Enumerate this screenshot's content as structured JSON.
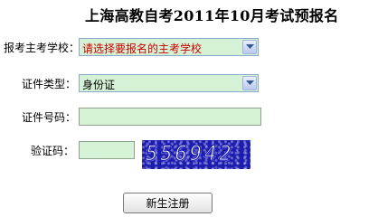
{
  "page": {
    "title": "上海高教自考2011年10月考试预报名"
  },
  "form": {
    "school": {
      "label": "报考主考学校：",
      "value": "请选择要报名的主考学校"
    },
    "id_type": {
      "label": "证件类型：",
      "value": "身份证"
    },
    "id_number": {
      "label": "证件号码：",
      "value": ""
    },
    "captcha": {
      "label": "验证码：",
      "value": "",
      "image_text": "556942"
    },
    "submit_label": "新生注册"
  },
  "colors": {
    "field_background": "#d6f2d6",
    "placeholder_text": "#cc0000",
    "captcha_background": "#1c1cb0"
  },
  "icons": {
    "select_arrow": "chevron-down-icon"
  }
}
